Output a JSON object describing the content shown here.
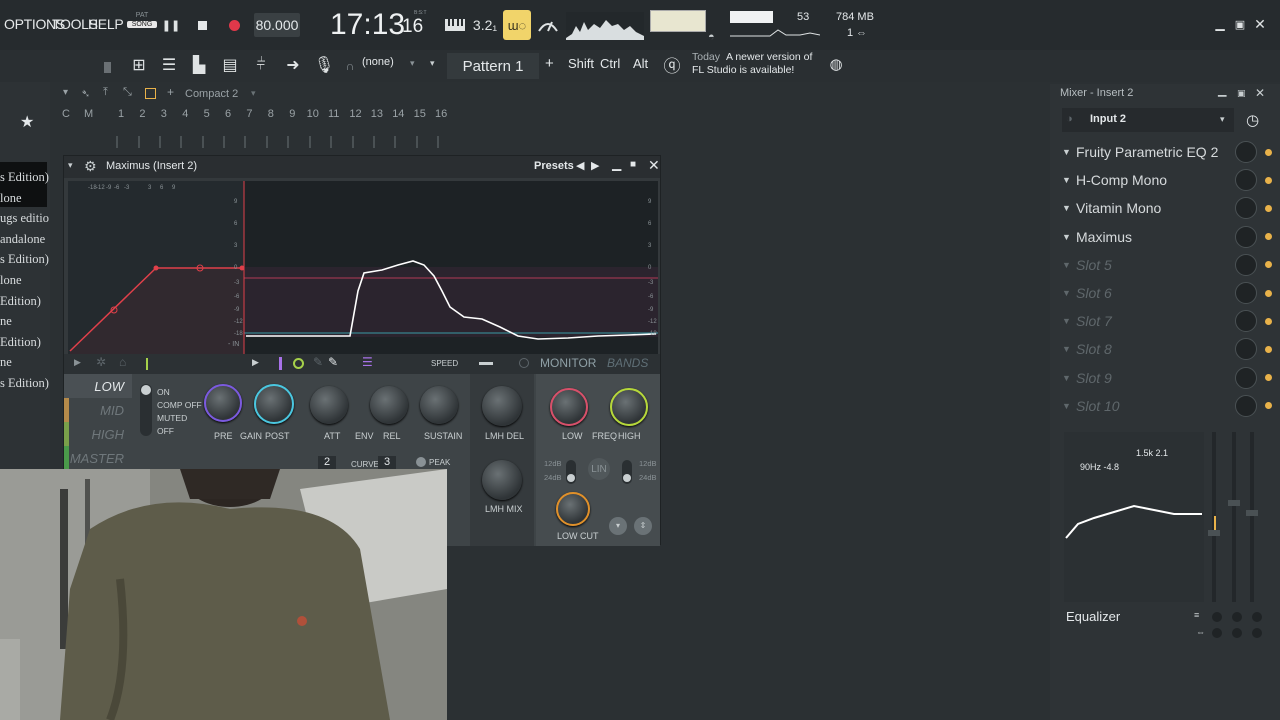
{
  "menu": [
    "OPTIONS",
    "TOOLS",
    "HELP"
  ],
  "transport": {
    "pat_label": "PAT",
    "song_label": "SONG",
    "tempo": "80.000",
    "time_main": "17:13",
    "time_sub": "16",
    "time_small": "B:S:T",
    "snap": "3.2₁",
    "cpu_value": "53",
    "ram_value": "784 MB",
    "poly_value": "1"
  },
  "toolbar2": {
    "none_select": "(none)",
    "pattern_label": "Pattern 1",
    "plus": "+",
    "keys": [
      "Shift",
      "Ctrl",
      "Alt"
    ],
    "news_today": "Today",
    "news_text_1": "A newer version of",
    "news_text_2": "FL Studio is available!"
  },
  "rack": {
    "title": "Compact 2",
    "col_c": "C",
    "col_m": "M",
    "steps": [
      "1",
      "2",
      "3",
      "4",
      "5",
      "6",
      "7",
      "8",
      "9",
      "10",
      "11",
      "12",
      "13",
      "14",
      "15",
      "16"
    ]
  },
  "browser_items": [
    "s Edition)",
    "lone",
    "ugs editio",
    "andalone",
    "s Edition)",
    "lone",
    " Edition)",
    "ne",
    " Edition)",
    "ne",
    "s Edition)"
  ],
  "plugin": {
    "title": "Maximus (Insert 2)",
    "presets": "Presets",
    "db_scale_top": [
      "-18",
      "-12",
      "-9",
      "-6",
      "-3",
      "3",
      "6",
      "9"
    ],
    "right_scale": [
      "9",
      "6",
      "3",
      "0",
      "-3",
      "-6",
      "-9",
      "-12",
      "-18"
    ],
    "in_label": "- IN",
    "speed_label": "SPEED",
    "tab_monitor": "MONITOR",
    "tab_bands": "BANDS",
    "bands": [
      "LOW",
      "MID",
      "HIGH",
      "MASTER"
    ],
    "state_options": [
      "ON",
      "COMP OFF",
      "MUTED",
      "OFF"
    ],
    "knob_labels": [
      "PRE",
      "GAIN",
      "POST",
      "ATT",
      "ENV",
      "REL",
      "SUSTAIN",
      "LMH DEL",
      "LMH MIX",
      "LOW",
      "FREQ",
      "HIGH",
      "LOW CUT"
    ],
    "curve_label": "CURVE",
    "curve_a": "2",
    "curve_b": "3",
    "peak_label": "PEAK",
    "db12": "12dB",
    "db24": "24dB",
    "lin_label": "LIN"
  },
  "mixer": {
    "title": "Mixer - Insert 2",
    "input": "Input 2",
    "slots": [
      {
        "name": "Fruity Parametric EQ 2",
        "empty": false
      },
      {
        "name": "H-Comp Mono",
        "empty": false
      },
      {
        "name": "Vitamin Mono",
        "empty": false
      },
      {
        "name": "Maximus",
        "empty": false
      },
      {
        "name": "Slot 5",
        "empty": true
      },
      {
        "name": "Slot 6",
        "empty": true
      },
      {
        "name": "Slot 7",
        "empty": true
      },
      {
        "name": "Slot 8",
        "empty": true
      },
      {
        "name": "Slot 9",
        "empty": true
      },
      {
        "name": "Slot 10",
        "empty": true
      }
    ],
    "eq_label_low": "90Hz -4.8",
    "eq_label_mid": "1.5k 2.1",
    "equalizer": "Equalizer"
  },
  "colors": {
    "accent": "#e9b24a",
    "graph_curve": "#ffffff",
    "env_line": "#e0404a",
    "monitor": "#8fa0a6"
  }
}
